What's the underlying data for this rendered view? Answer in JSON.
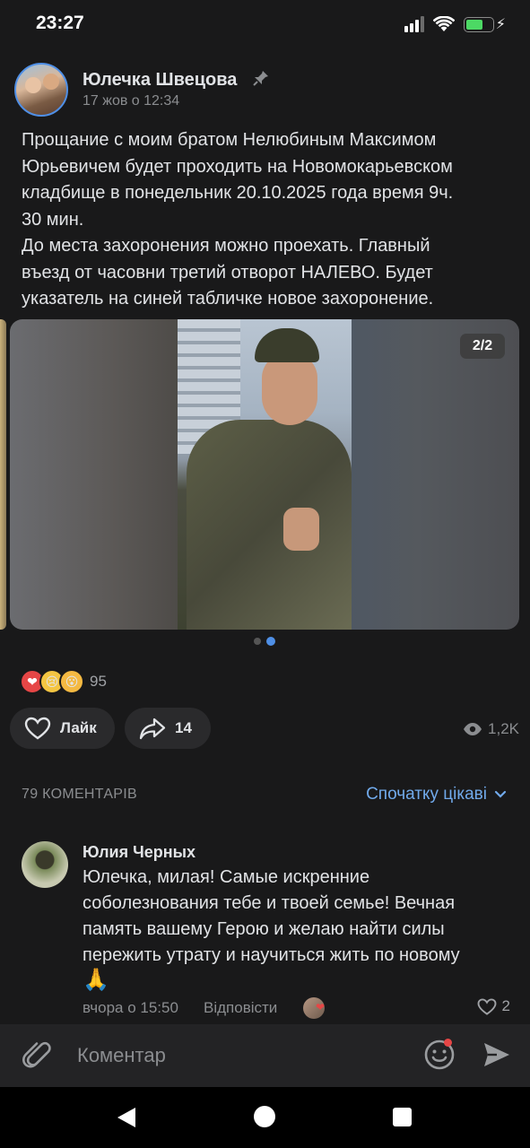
{
  "status_bar": {
    "time": "23:27",
    "battery_level": 0.6
  },
  "post": {
    "author": "Юлечка Швецова",
    "date": "17 жов о 12:34",
    "text": "Прощание с моим братом Нелюбиным Максимом\nЮрьевичем будет проходить на Новомокарьевском\nкладбище в понедельник 20.10.2025 года время 9ч.\n30 мин.\nДо места захоронения можно проехать. Главный\nвъезд от часовни третий отворот НАЛЕВО. Будет\nуказатель на синей табличке новое захоронение.",
    "media_counter": "2/2",
    "reactions": [
      "heart",
      "crying-face",
      "astonished-face"
    ],
    "reactions_count": "95",
    "like_label": "Лайк",
    "share_count": "14",
    "views": "1,2K"
  },
  "comments": {
    "count_label": "79 КОМЕНТАРІВ",
    "sort_label": "Спочатку цікаві",
    "items": [
      {
        "author": "Юлия Черных",
        "text": "Юлечка, милая! Самые искренние\nсоболезнования тебе и твоей семье! Вечная\nпамять вашему Герою и желаю найти силы\nпережить утрату и научиться жить по новому",
        "emoji": "🙏",
        "time": "вчора о 15:50",
        "reply_label": "Відповісти",
        "likes": "2"
      }
    ]
  },
  "composer": {
    "placeholder": "Коментар"
  },
  "colors": {
    "accent": "#71aaeb",
    "background": "#19191a",
    "heart": "#e64646"
  }
}
